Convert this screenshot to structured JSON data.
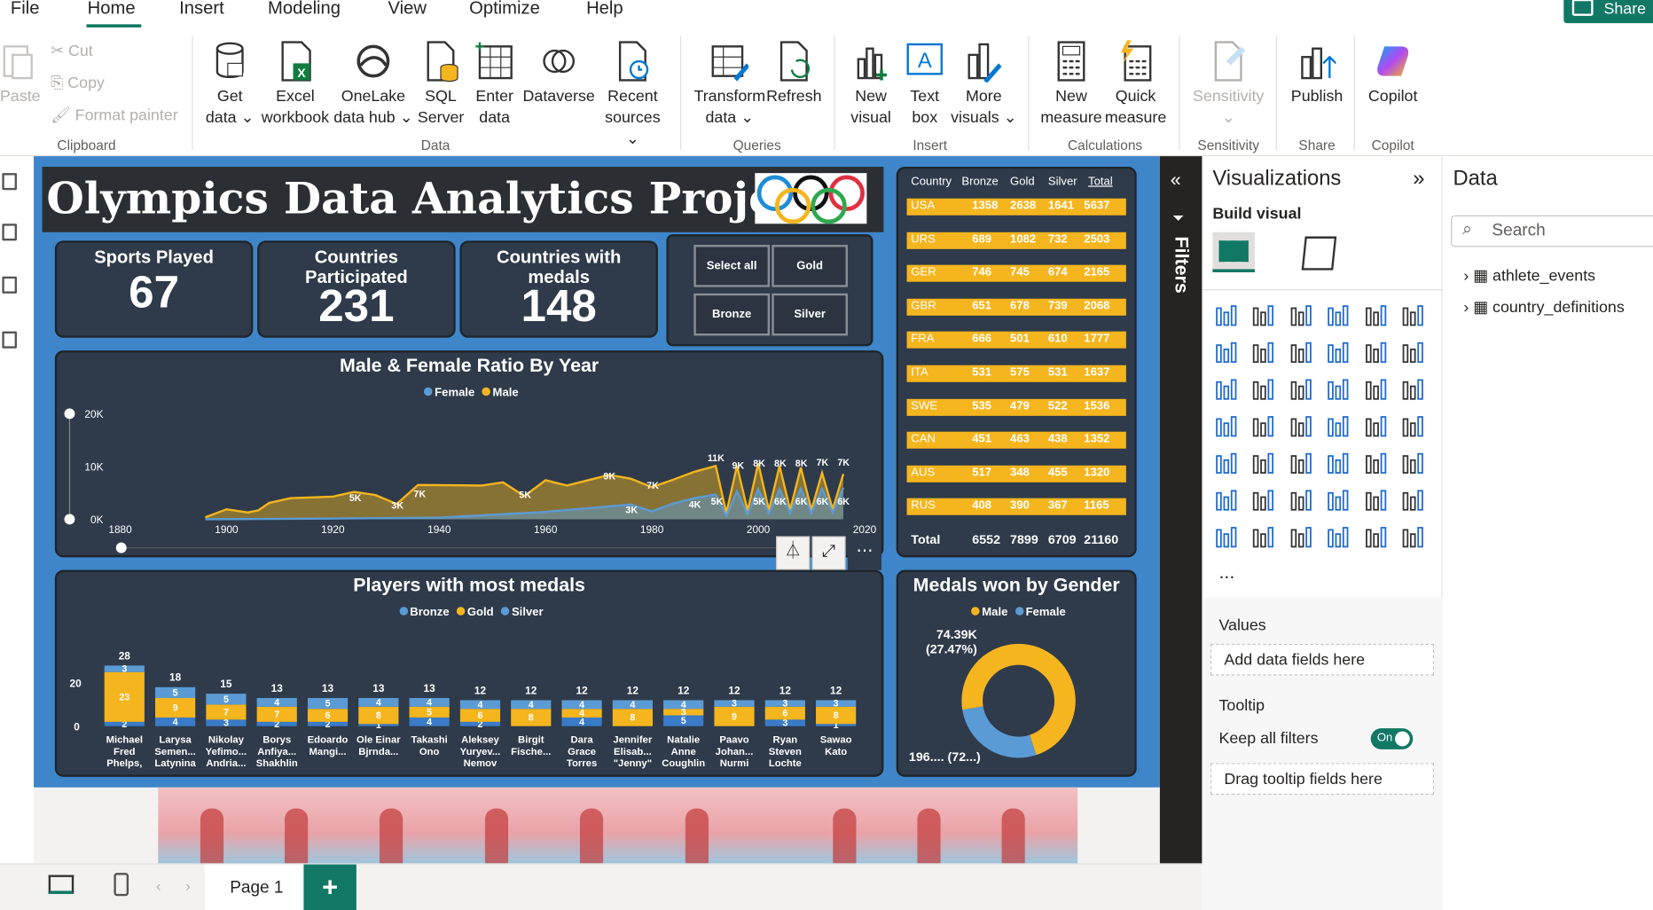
{
  "menu": {
    "file": "File",
    "home": "Home",
    "insert": "Insert",
    "modeling": "Modeling",
    "view": "View",
    "optimize": "Optimize",
    "help": "Help",
    "share": "Share"
  },
  "ribbon": {
    "clipboard": {
      "paste": "Paste",
      "cut": "Cut",
      "copy": "Copy",
      "format_painter": "Format painter",
      "group": "Clipboard"
    },
    "data": {
      "get_data": [
        "Get",
        "data ⌄"
      ],
      "excel": [
        "Excel",
        "workbook"
      ],
      "onelake": [
        "OneLake",
        "data hub ⌄"
      ],
      "sql": [
        "SQL",
        "Server"
      ],
      "enter": [
        "Enter",
        "data"
      ],
      "dataverse": [
        "Dataverse",
        ""
      ],
      "recent": [
        "Recent",
        "sources ⌄"
      ],
      "group": "Data"
    },
    "queries": {
      "transform": [
        "Transform",
        "data ⌄"
      ],
      "refresh": [
        "Refresh",
        ""
      ],
      "group": "Queries"
    },
    "insert": {
      "new_visual": [
        "New",
        "visual"
      ],
      "text_box": [
        "Text",
        "box"
      ],
      "more_visuals": [
        "More",
        "visuals ⌄"
      ],
      "group": "Insert"
    },
    "calculations": {
      "new_measure": [
        "New",
        "measure"
      ],
      "quick_measure": [
        "Quick",
        "measure"
      ],
      "group": "Calculations"
    },
    "sensitivity": {
      "label": [
        "Sensitivity",
        "⌄"
      ],
      "group": "Sensitivity"
    },
    "share": {
      "publish": "Publish",
      "group": "Share"
    },
    "copilot": {
      "label": "Copilot",
      "group": "Copilot"
    }
  },
  "report": {
    "title": "Olympics Data Analytics Project",
    "cards": [
      {
        "label": "Sports Played",
        "value": "67"
      },
      {
        "label": "Countries Participated",
        "value": "231"
      },
      {
        "label": "Countries with medals",
        "value": "148"
      }
    ],
    "slicer": [
      "Select all",
      "Gold",
      "Bronze",
      "Silver"
    ],
    "line_chart": {
      "title": "Male & Female Ratio By Year",
      "legend": [
        "Female",
        "Male"
      ]
    },
    "bar_chart": {
      "title": "Players with most medals",
      "legend": [
        "Bronze",
        "Gold",
        "Silver"
      ]
    },
    "donut": {
      "title": "Medals won by Gender",
      "legend": [
        "Male",
        "Female"
      ],
      "label_top_1": "74.39K",
      "label_top_2": "(27.47%)",
      "label_bottom": "196.... (72...)"
    },
    "table": {
      "headers": [
        "Country",
        "Bronze",
        "Gold",
        "Silver",
        "Total"
      ],
      "rows": [
        [
          "USA",
          "1358",
          "2638",
          "1641",
          "5637"
        ],
        [
          "URS",
          "689",
          "1082",
          "732",
          "2503"
        ],
        [
          "GER",
          "746",
          "745",
          "674",
          "2165"
        ],
        [
          "GBR",
          "651",
          "678",
          "739",
          "2068"
        ],
        [
          "FRA",
          "666",
          "501",
          "610",
          "1777"
        ],
        [
          "ITA",
          "531",
          "575",
          "531",
          "1637"
        ],
        [
          "SWE",
          "535",
          "479",
          "522",
          "1536"
        ],
        [
          "CAN",
          "451",
          "463",
          "438",
          "1352"
        ],
        [
          "AUS",
          "517",
          "348",
          "455",
          "1320"
        ],
        [
          "RUS",
          "408",
          "390",
          "367",
          "1165"
        ]
      ],
      "total": [
        "Total",
        "6552",
        "7899",
        "6709",
        "21160"
      ]
    }
  },
  "chart_data": [
    {
      "type": "area",
      "title": "Male & Female Ratio By Year",
      "x_ticks": [
        "1880",
        "1900",
        "1920",
        "1940",
        "1960",
        "1980",
        "2000",
        "2020"
      ],
      "y_ticks": [
        "0K",
        "10K",
        "20K"
      ],
      "ylim": [
        0,
        20000
      ],
      "xlim": [
        1880,
        2020
      ],
      "series": [
        {
          "name": "Male",
          "x": [
            1896,
            1900,
            1904,
            1906,
            1908,
            1912,
            1920,
            1924,
            1928,
            1932,
            1936,
            1948,
            1952,
            1956,
            1960,
            1964,
            1968,
            1972,
            1976,
            1980,
            1984,
            1988,
            1992,
            1994,
            1996,
            1998,
            2000,
            2002,
            2004,
            2006,
            2008,
            2010,
            2012,
            2014,
            2016
          ],
          "y": [
            380,
            1900,
            1300,
            1700,
            3100,
            4000,
            4300,
            5200,
            4600,
            2900,
            6500,
            6400,
            7000,
            4400,
            7400,
            6400,
            7400,
            8400,
            7700,
            6100,
            7500,
            9000,
            10100,
            1200,
            10100,
            1600,
            10600,
            1700,
            10100,
            1800,
            9800,
            1800,
            8800,
            1900,
            8600
          ]
        },
        {
          "name": "Female",
          "x": [
            1896,
            1900,
            1920,
            1940,
            1960,
            1976,
            1980,
            1984,
            1988,
            1992,
            1994,
            1996,
            1998,
            2000,
            2002,
            2004,
            2006,
            2008,
            2010,
            2012,
            2014,
            2016
          ],
          "y": [
            0,
            20,
            140,
            300,
            1400,
            2800,
            1500,
            3000,
            4000,
            4700,
            650,
            5300,
            950,
            5700,
            1100,
            5700,
            1150,
            5800,
            1200,
            5800,
            1250,
            6000
          ]
        }
      ],
      "point_labels": [
        "5K",
        "3K",
        "7K",
        "5K",
        "9K",
        "3K",
        "7K",
        "4K",
        "11K",
        "9K",
        "5K",
        "8K",
        "5K",
        "8K",
        "6K",
        "8K",
        "6K",
        "7K",
        "6K",
        "7K",
        "6K"
      ]
    },
    {
      "type": "bar",
      "title": "Players with most medals",
      "categories": [
        "Michael Fred Phelps, II",
        "Larysa Semen... Latynina",
        "Nikolay Yefimo... Andria...",
        "Borys Anfiya... Shakhlin",
        "Edoardo Mangi...",
        "Ole Einar Bjrnda...",
        "Takashi Ono",
        "Aleksey Yuryev... Nemov",
        "Birgit Fische...",
        "Dara Grace Torres",
        "Jennifer Elisab... \"Jenny\"",
        "Natalie Anne Coughlin",
        "Paavo Johan... Nurmi",
        "Ryan Steven Lochte",
        "Sawao Kato"
      ],
      "totals": [
        28,
        18,
        15,
        13,
        13,
        13,
        13,
        12,
        12,
        12,
        12,
        12,
        12,
        12,
        12
      ],
      "y_ticks": [
        "0",
        "20"
      ],
      "series": [
        {
          "name": "Bronze",
          "values": [
            2,
            4,
            3,
            2,
            2,
            1,
            4,
            2,
            0,
            4,
            0,
            5,
            0,
            3,
            1
          ]
        },
        {
          "name": "Gold",
          "values": [
            23,
            9,
            7,
            7,
            6,
            8,
            5,
            6,
            8,
            4,
            8,
            3,
            9,
            6,
            8
          ]
        },
        {
          "name": "Silver",
          "values": [
            3,
            5,
            5,
            4,
            5,
            4,
            4,
            4,
            4,
            4,
            4,
            4,
            3,
            3,
            3
          ]
        }
      ],
      "segment_labels": [
        "23",
        "5",
        "9",
        "4",
        "5",
        "7",
        "4",
        "7",
        "5",
        "6",
        "4",
        "8",
        "4",
        "5",
        "4",
        "6",
        "4",
        "8",
        "4",
        "4",
        "8",
        "4",
        "5",
        "9",
        "6",
        "8"
      ]
    },
    {
      "type": "pie",
      "title": "Medals won by Gender",
      "categories": [
        "Male",
        "Female"
      ],
      "values": [
        196000,
        74390
      ]
    }
  ],
  "filters": {
    "label": "Filters"
  },
  "viz": {
    "title": "Visualizations",
    "build": "Build visual",
    "values": "Values",
    "add_fields": "Add data fields here",
    "tooltip": "Tooltip",
    "keep_filters": "Keep all filters",
    "toggle": "On",
    "drag_tooltip": "Drag tooltip fields here",
    "more": "..."
  },
  "datapane": {
    "title": "Data",
    "search_placeholder": "Search",
    "tables": [
      "athlete_events",
      "country_definitions"
    ]
  },
  "pages": {
    "tab": "Page 1",
    "add": "+"
  },
  "colors": {
    "accent": "#117865",
    "gold": "#f5b51e",
    "blue": "#5b9bd5",
    "report_bg": "#3e86c9",
    "panel": "#2f3b4a"
  }
}
